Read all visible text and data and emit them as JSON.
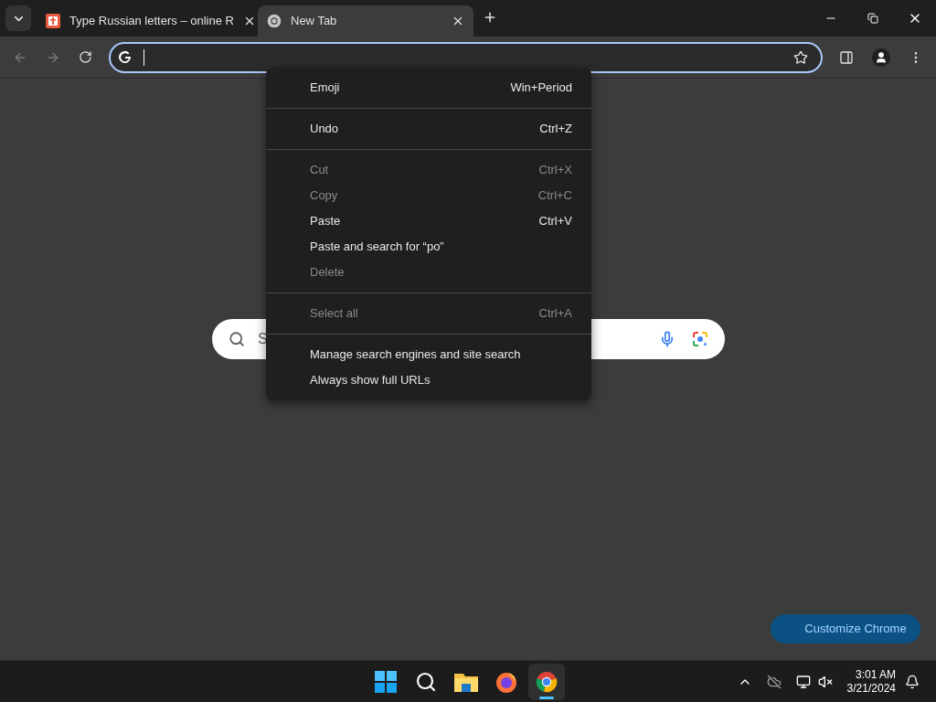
{
  "tabs": [
    {
      "title": "Type Russian letters – online R",
      "selected": false,
      "kind": "site"
    },
    {
      "title": "New Tab",
      "selected": true,
      "kind": "chrome"
    }
  ],
  "search_box": {
    "placeholder": "S"
  },
  "context_menu": {
    "groups": [
      [
        {
          "label": "Emoji",
          "shortcut": "Win+Period",
          "disabled": false
        }
      ],
      [
        {
          "label": "Undo",
          "shortcut": "Ctrl+Z",
          "disabled": false
        }
      ],
      [
        {
          "label": "Cut",
          "shortcut": "Ctrl+X",
          "disabled": true
        },
        {
          "label": "Copy",
          "shortcut": "Ctrl+C",
          "disabled": true
        },
        {
          "label": "Paste",
          "shortcut": "Ctrl+V",
          "disabled": false
        },
        {
          "label": "Paste and search for “po”",
          "disabled": false
        },
        {
          "label": "Delete",
          "disabled": true
        }
      ],
      [
        {
          "label": "Select all",
          "shortcut": "Ctrl+A",
          "disabled": true
        }
      ],
      [
        {
          "label": "Manage search engines and site search",
          "disabled": false
        },
        {
          "label": "Always show full URLs",
          "disabled": false
        }
      ]
    ]
  },
  "customize_button": "Customize Chrome",
  "taskbar": {
    "apps": [
      {
        "kind": "start",
        "selected": false
      },
      {
        "kind": "search",
        "selected": false
      },
      {
        "kind": "files",
        "selected": false
      },
      {
        "kind": "firefox",
        "selected": false
      },
      {
        "kind": "chrome",
        "selected": true
      }
    ],
    "time": "3:01 AM",
    "date": "3/21/2024"
  }
}
